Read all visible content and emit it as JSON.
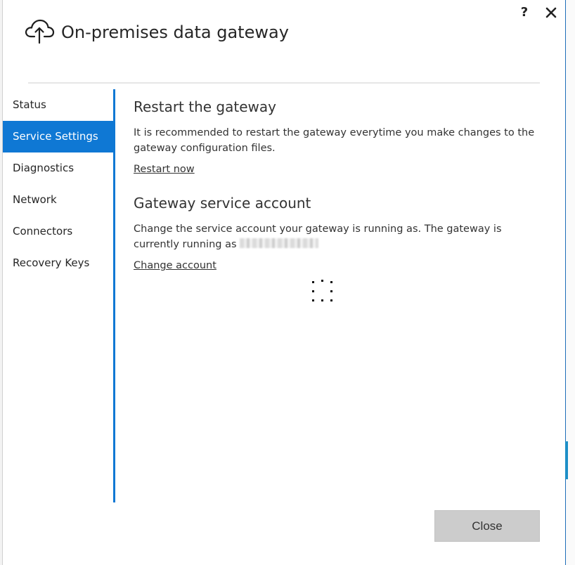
{
  "app": {
    "title": "On-premises data gateway",
    "icon": "cloud-upload-icon",
    "help_label": "?",
    "accent": "#0f78d4"
  },
  "nav": {
    "items": [
      {
        "label": "Status",
        "active": false
      },
      {
        "label": "Service Settings",
        "active": true
      },
      {
        "label": "Diagnostics",
        "active": false
      },
      {
        "label": "Network",
        "active": false
      },
      {
        "label": "Connectors",
        "active": false
      },
      {
        "label": "Recovery Keys",
        "active": false
      }
    ]
  },
  "restart": {
    "heading": "Restart the gateway",
    "description": "It is recommended to restart the gateway everytime you make changes to the gateway configuration files.",
    "link": "Restart now"
  },
  "service_account": {
    "heading": "Gateway service account",
    "description": "Change the service account your gateway is running as. The gateway is currently running as",
    "link": "Change account"
  },
  "footer": {
    "close_label": "Close"
  }
}
